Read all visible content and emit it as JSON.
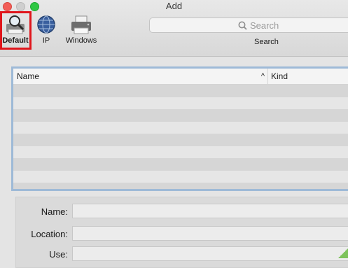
{
  "window": {
    "title": "Add"
  },
  "toolbar": {
    "tools": [
      {
        "label": "Default",
        "icon": "magnifier-printer-icon",
        "selected": true
      },
      {
        "label": "IP",
        "icon": "globe-icon"
      },
      {
        "label": "Windows",
        "icon": "printer-icon"
      }
    ],
    "search": {
      "placeholder": "Search",
      "label": "Search"
    }
  },
  "table": {
    "columns": [
      "Name",
      "Kind"
    ],
    "sort_indicator": "^",
    "rows": []
  },
  "form": {
    "name_label": "Name:",
    "location_label": "Location:",
    "use_label": "Use:",
    "name_value": "",
    "location_value": "",
    "use_value": ""
  },
  "colors": {
    "highlight": "#e0151b",
    "table_focus": "#9ebad7",
    "close": "#f25e57",
    "zoom": "#2fc743"
  }
}
